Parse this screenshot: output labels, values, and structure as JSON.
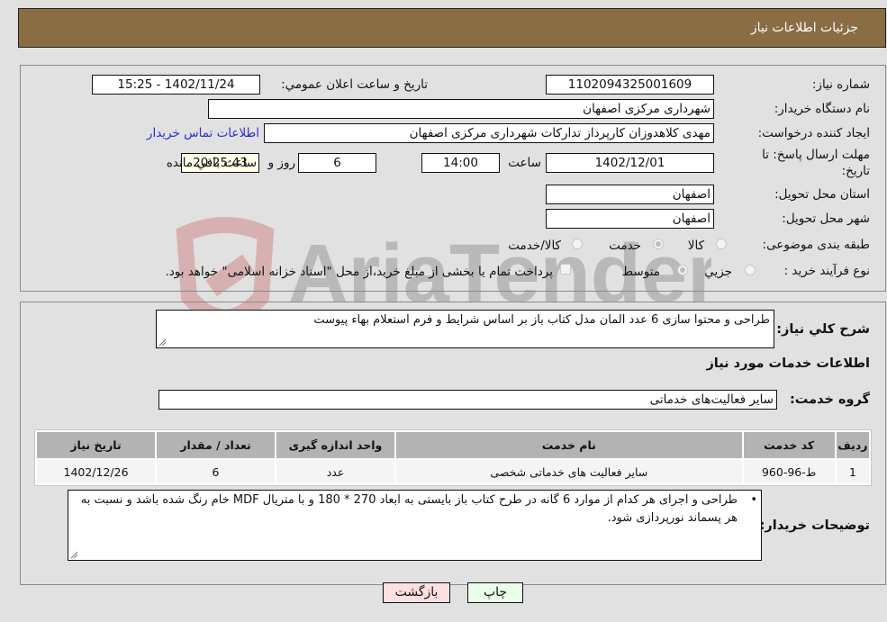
{
  "header": {
    "title": "جزئیات اطلاعات نیاز"
  },
  "details": {
    "need_number_label": "شماره نیاز:",
    "need_number": "1102094325001609",
    "announce_label": "تاریخ و ساعت اعلان عمومي:",
    "announce_value": "1402/11/24 - 15:25",
    "buyer_org_label": "نام دستگاه خریدار:",
    "buyer_org": "شهرداری مرکزی اصفهان",
    "creator_label": "ایجاد کننده درخواست:",
    "creator": "مهدی کلاهدوزان کارپرداز تدارکات شهرداری مرکزی اصفهان",
    "contact_link": "اطلاعات تماس خریدار",
    "deadline_label_line1": "مهلت ارسال پاسخ: تا",
    "deadline_label_line2": "تاریخ:",
    "deadline_date": "1402/12/01",
    "time_label": "ساعت",
    "deadline_time": "14:00",
    "days_value": "6",
    "days_label": "روز و",
    "remaining_time": "20:25:43",
    "remaining_label": "ساعت باقي مانده",
    "province_label": "استان محل تحویل:",
    "province": "اصفهان",
    "city_label": "شهر محل تحویل:",
    "city": "اصفهان",
    "category_label": "طبقه بندی موضوعی:",
    "category_options": [
      {
        "label": "کالا",
        "checked": false
      },
      {
        "label": "خدمت",
        "checked": true
      },
      {
        "label": "کالا/خدمت",
        "checked": false
      }
    ],
    "process_label": "نوع فرآیند خرید :",
    "process_options": [
      {
        "label": "جزيي",
        "checked": false
      },
      {
        "label": "متوسط",
        "checked": true
      }
    ],
    "treasury_note": "پرداخت تمام یا بخشی از مبلغ خرید،از محل \"اسناد خزانه اسلامی\" خواهد بود."
  },
  "services": {
    "summary_label": "شرح کلي نیاز:",
    "summary": "طراحی و محتوا سازی 6 عدد المان مدل کتاب باز بر اساس شرایط و فرم استعلام بهاء پیوست",
    "section_title": "اطلاعات خدمات مورد نیاز",
    "group_label": "گروه خدمت:",
    "group_value": "سایر فعالیت‌های خدماتی",
    "table": {
      "headers": [
        "ردیف",
        "کد خدمت",
        "نام خدمت",
        "واحد اندازه گیری",
        "تعداد / مقدار",
        "تاریخ نیاز"
      ],
      "rows": [
        [
          "1",
          "ط-96-960",
          "سایر فعالیت های خدماتی شخصی",
          "عدد",
          "6",
          "1402/12/26"
        ]
      ]
    },
    "buyer_notes_label": "توضیحات خریدار:",
    "buyer_notes": "طراحی و اجرای هر کدام از موارد 6 گانه در طرح کتاب باز بایستی به ابعاد 270 * 180  و با متریال MDF خام رنگ شده باشد و نسبت به هر پسماند نورپردازی شود."
  },
  "buttons": {
    "print": "چاپ",
    "back": "بازگشت"
  },
  "watermark": {
    "text": "AriaTender.neT"
  },
  "colors": {
    "header_bg": "#8b6d43",
    "link": "#2a2ae0",
    "print_bg": "#eaffea",
    "back_bg": "#ffe0e0",
    "remaining_bg": "#ffffe8"
  }
}
